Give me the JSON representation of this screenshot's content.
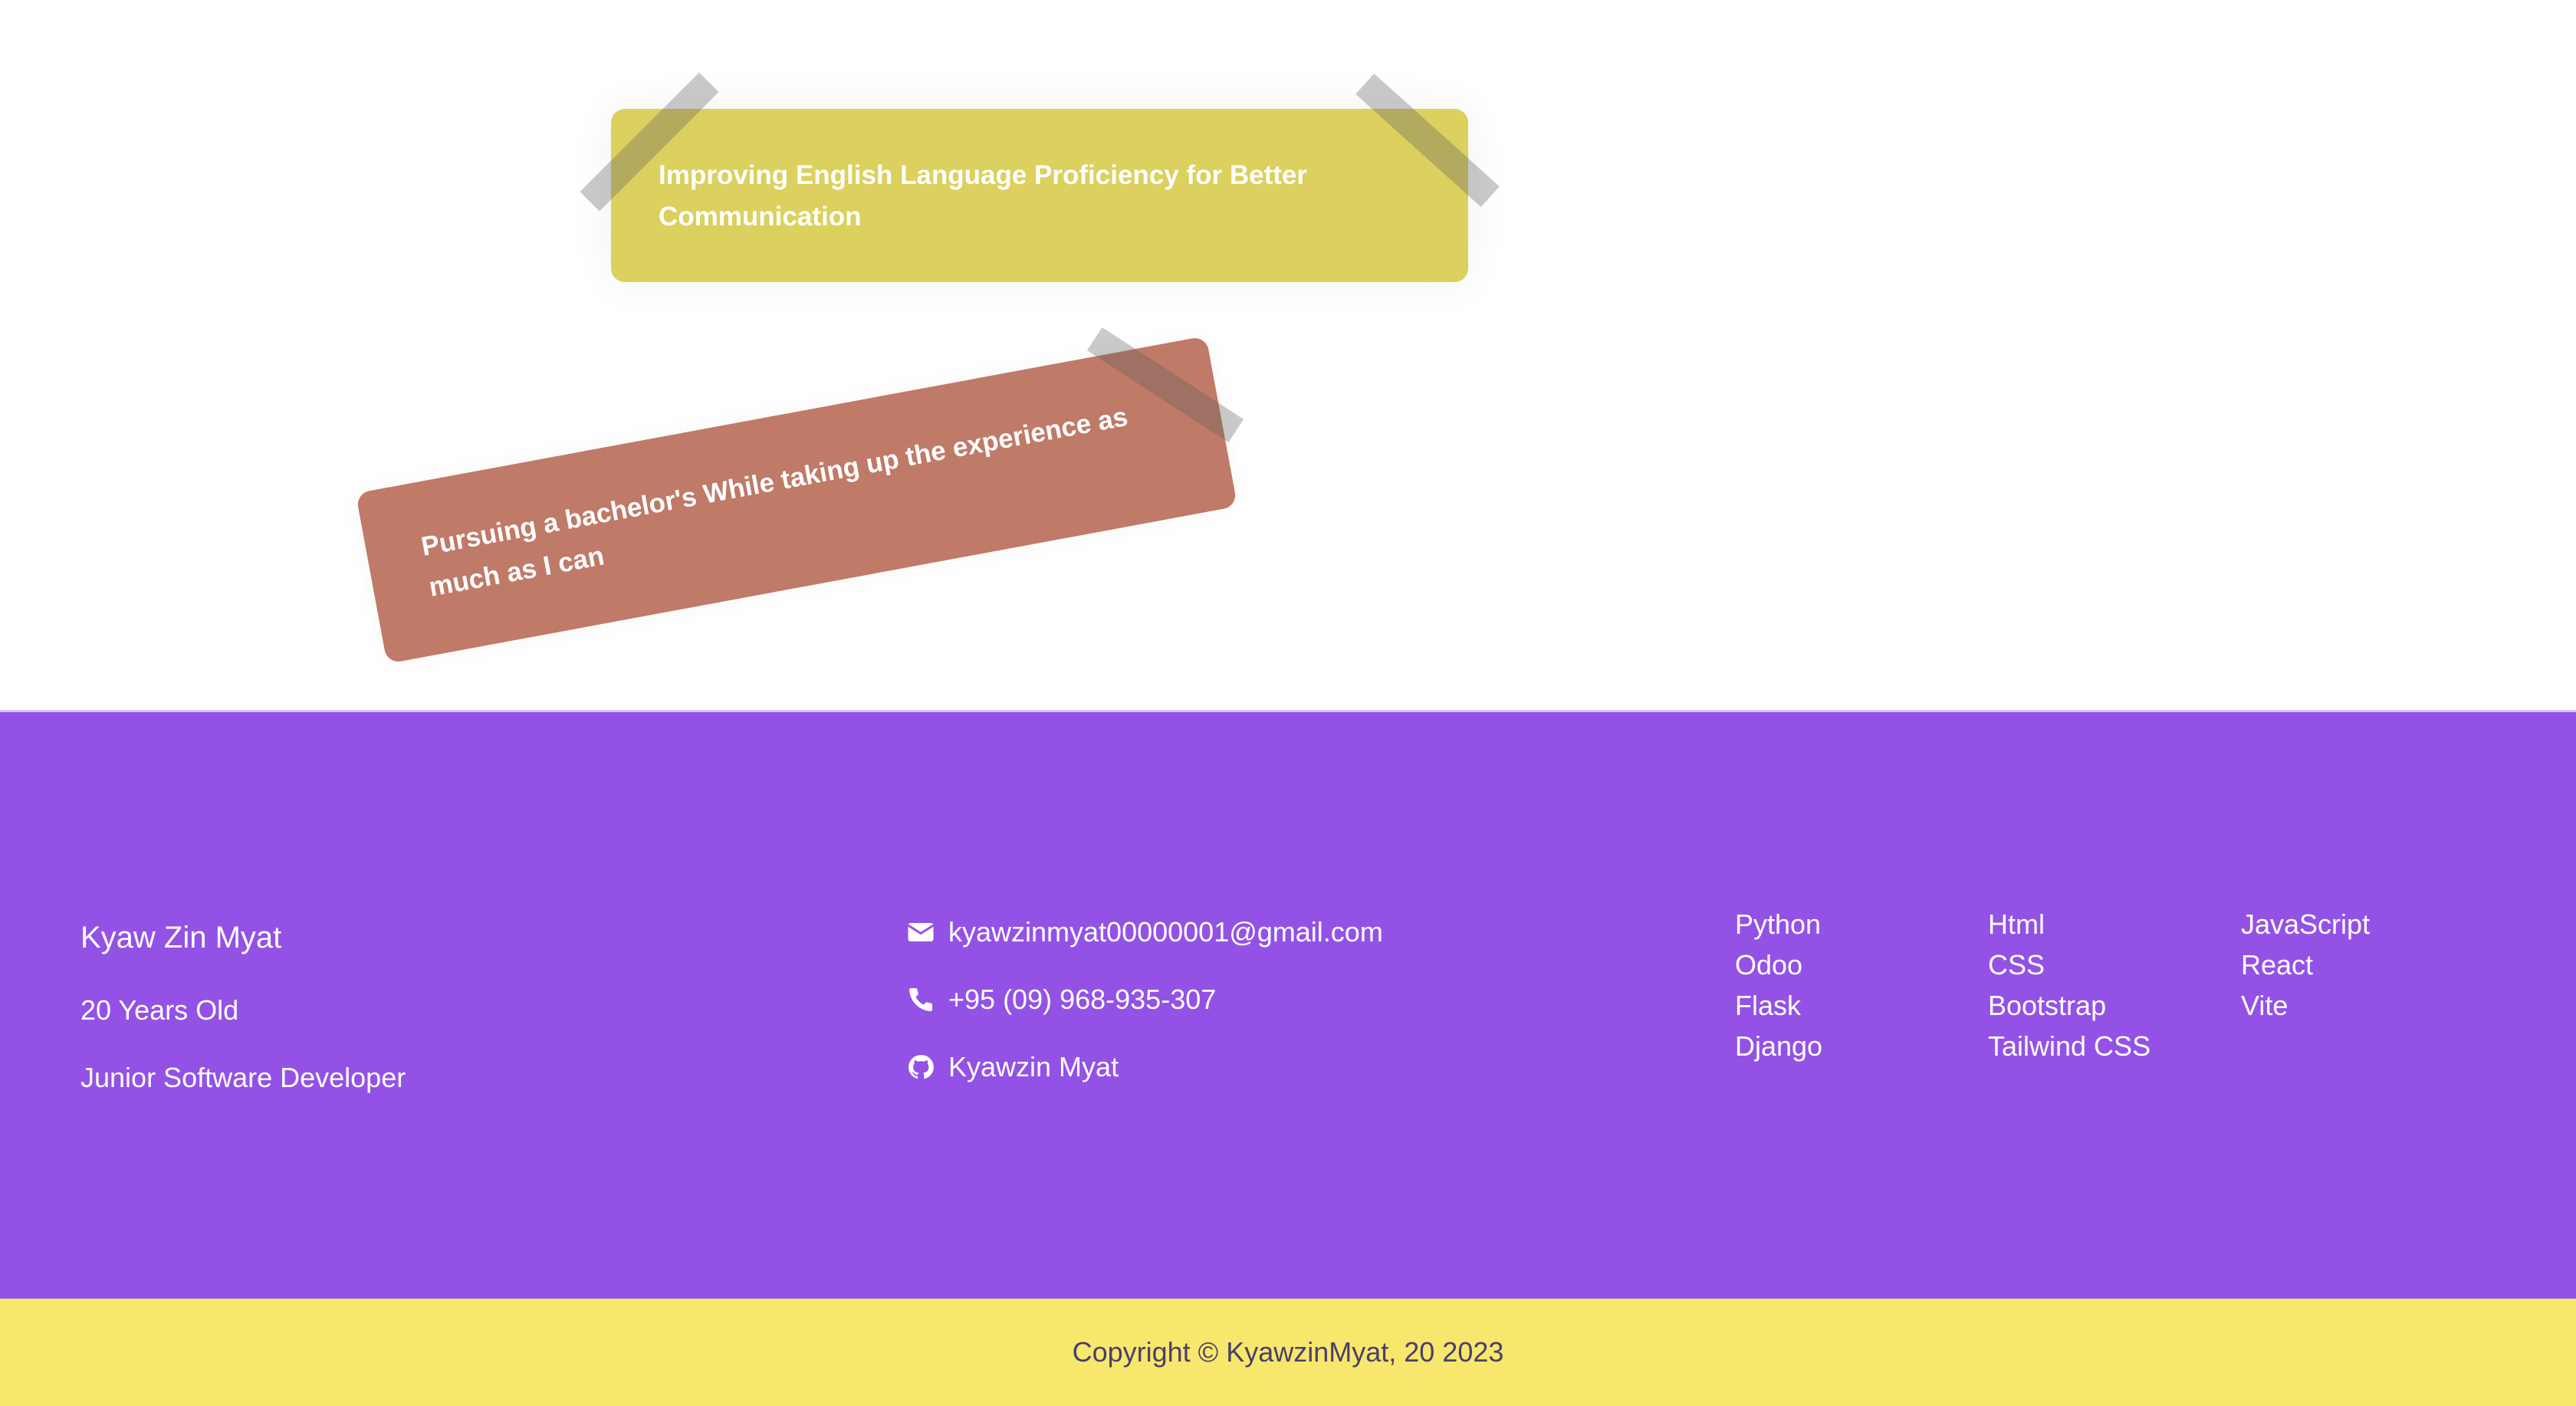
{
  "notes": {
    "yellow": "Improving English Language Proficiency for Better Communication",
    "red": "Pursuing a bachelor's While taking up the experience as much as I can"
  },
  "footer": {
    "name": "Kyaw Zin Myat",
    "age": "20 Years Old",
    "role": "Junior Software Developer",
    "contacts": {
      "email": "kyawzinmyat00000001@gmail.com",
      "phone": "+95 (09) 968-935-307",
      "github": "Kyawzin Myat"
    },
    "skills": {
      "col1": [
        "Python",
        "Odoo",
        "Flask",
        "Django"
      ],
      "col2": [
        "Html",
        "CSS",
        "Bootstrap",
        "Tailwind CSS"
      ],
      "col3": [
        "JavaScript",
        "React",
        "Vite"
      ]
    }
  },
  "copyright": "Copyright © KyawzinMyat, 20 2023",
  "colors": {
    "footer_bg": "#9352e5",
    "copyright_bg": "#f7e76d",
    "note_yellow": "#dcd05e",
    "note_red": "#bf7a68"
  },
  "icons": {
    "email": "envelope-icon",
    "phone": "phone-icon",
    "github": "github-icon"
  }
}
